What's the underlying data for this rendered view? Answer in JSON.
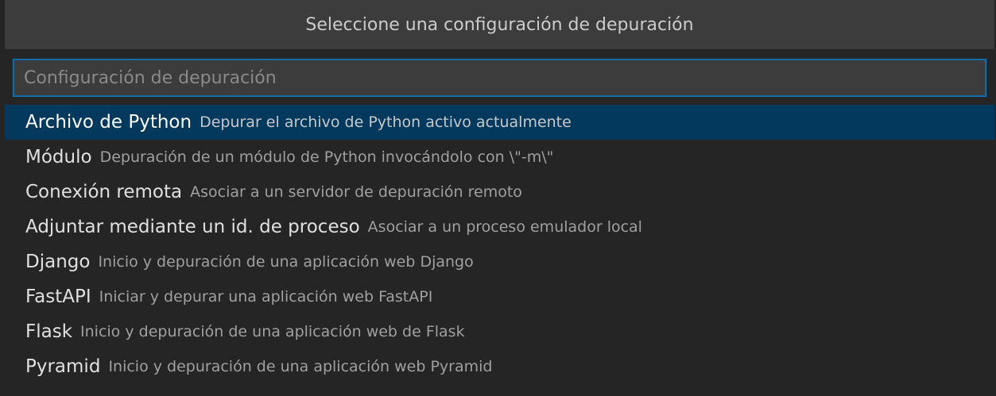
{
  "quick_pick": {
    "title": "Seleccione una configuración de depuración",
    "input": {
      "placeholder": "Configuración de depuración",
      "value": ""
    },
    "items": [
      {
        "label": "Archivo de Python",
        "description": "Depurar el archivo de Python activo actualmente",
        "selected": true
      },
      {
        "label": "Módulo",
        "description": "Depuración de un módulo de Python invocándolo con \\\"-m\\\"",
        "selected": false
      },
      {
        "label": "Conexión remota",
        "description": "Asociar a un servidor de depuración remoto",
        "selected": false
      },
      {
        "label": "Adjuntar mediante un id. de proceso",
        "description": "Asociar a un proceso emulador local",
        "selected": false
      },
      {
        "label": "Django",
        "description": "Inicio y depuración de una aplicación web Django",
        "selected": false
      },
      {
        "label": "FastAPI",
        "description": "Iniciar y depurar una aplicación web FastAPI",
        "selected": false
      },
      {
        "label": "Flask",
        "description": "Inicio y depuración de una aplicación web de Flask",
        "selected": false
      },
      {
        "label": "Pyramid",
        "description": "Inicio y depuración de una aplicación web Pyramid",
        "selected": false
      }
    ]
  },
  "colors": {
    "background": "#252526",
    "title_bar": "#3c3c3c",
    "selection": "#04395e",
    "focus_border": "#0e639c"
  }
}
